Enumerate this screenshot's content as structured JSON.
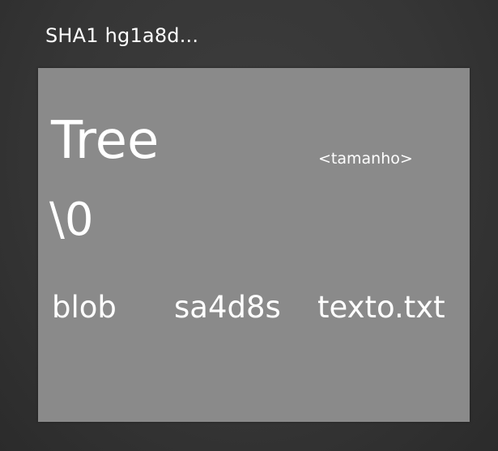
{
  "header": {
    "hash_label": "SHA1 hg1a8d..."
  },
  "object": {
    "type": "Tree",
    "size_placeholder": "<tamanho>",
    "separator": "\\0",
    "entries": [
      {
        "type": "blob",
        "hash": "sa4d8s",
        "name": "texto.txt"
      }
    ]
  },
  "colors": {
    "background": "#363636",
    "box": "#8a8a8a",
    "text": "#ffffff"
  }
}
